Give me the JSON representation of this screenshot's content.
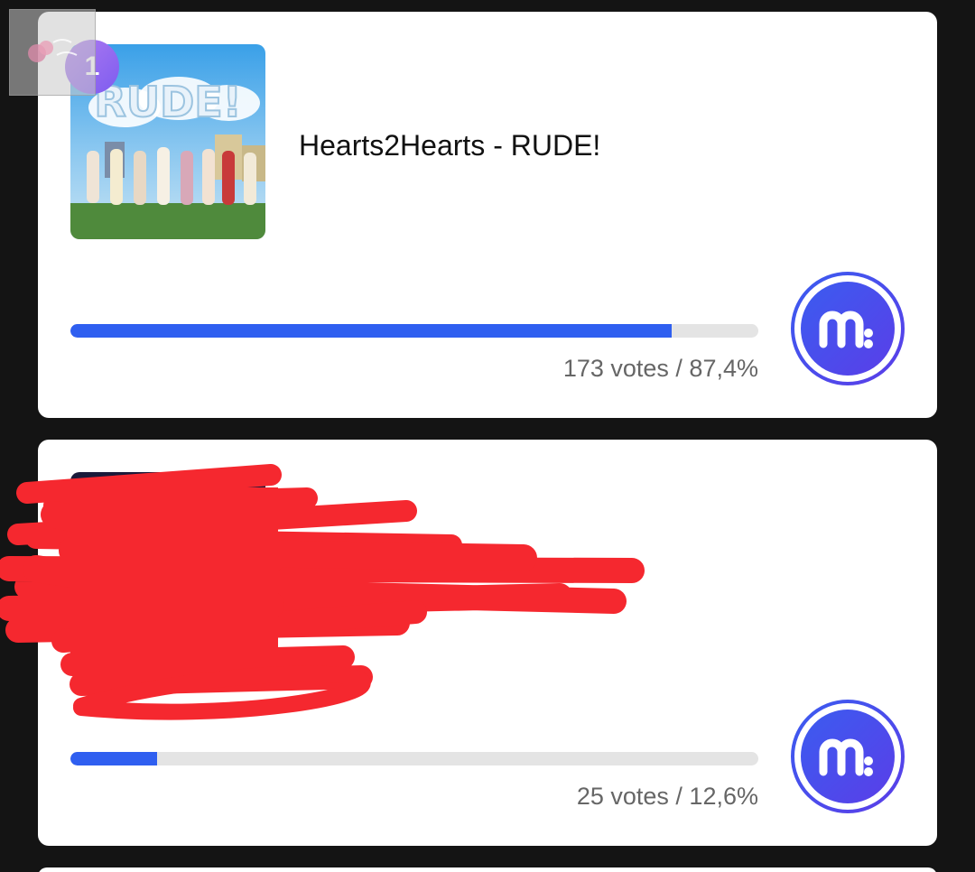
{
  "entries": [
    {
      "rank": "1",
      "title": "Hearts2Hearts - RUDE!",
      "cover_text": "RUDE!",
      "votes_text": "173 votes / 87,4%",
      "votes": 173,
      "percent": 87.4
    },
    {
      "rank": "",
      "title": "",
      "votes_text": "25 votes / 12,6%",
      "votes": 25,
      "percent": 12.6
    }
  ],
  "colors": {
    "progress": "#2f5ff0",
    "track": "#e4e4e4",
    "vote_button": "#4048e8",
    "redaction": "#f5282f"
  },
  "icons": {
    "vote_button": "m-logo-icon"
  }
}
